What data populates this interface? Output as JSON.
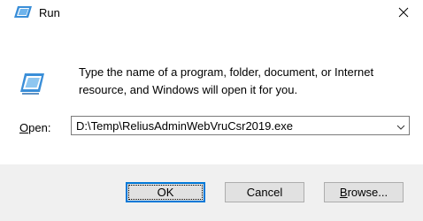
{
  "window": {
    "title": "Run",
    "close_glyph": "✕"
  },
  "dialog": {
    "icon": "run-icon",
    "description": "Type the name of a program, folder, document, or Internet resource, and Windows will open it for you.",
    "open_label_accel": "O",
    "open_label_rest": "pen:",
    "command_value": "D:\\Temp\\ReliusAdminWebVruCsr2019.exe"
  },
  "buttons": {
    "ok": "OK",
    "cancel": "Cancel",
    "browse_accel": "B",
    "browse_rest": "rowse..."
  },
  "colors": {
    "accent": "#0078d7",
    "footer_bg": "#f0f0f0",
    "button_bg": "#e1e1e1",
    "icon_blue": "#3a8ed8"
  }
}
